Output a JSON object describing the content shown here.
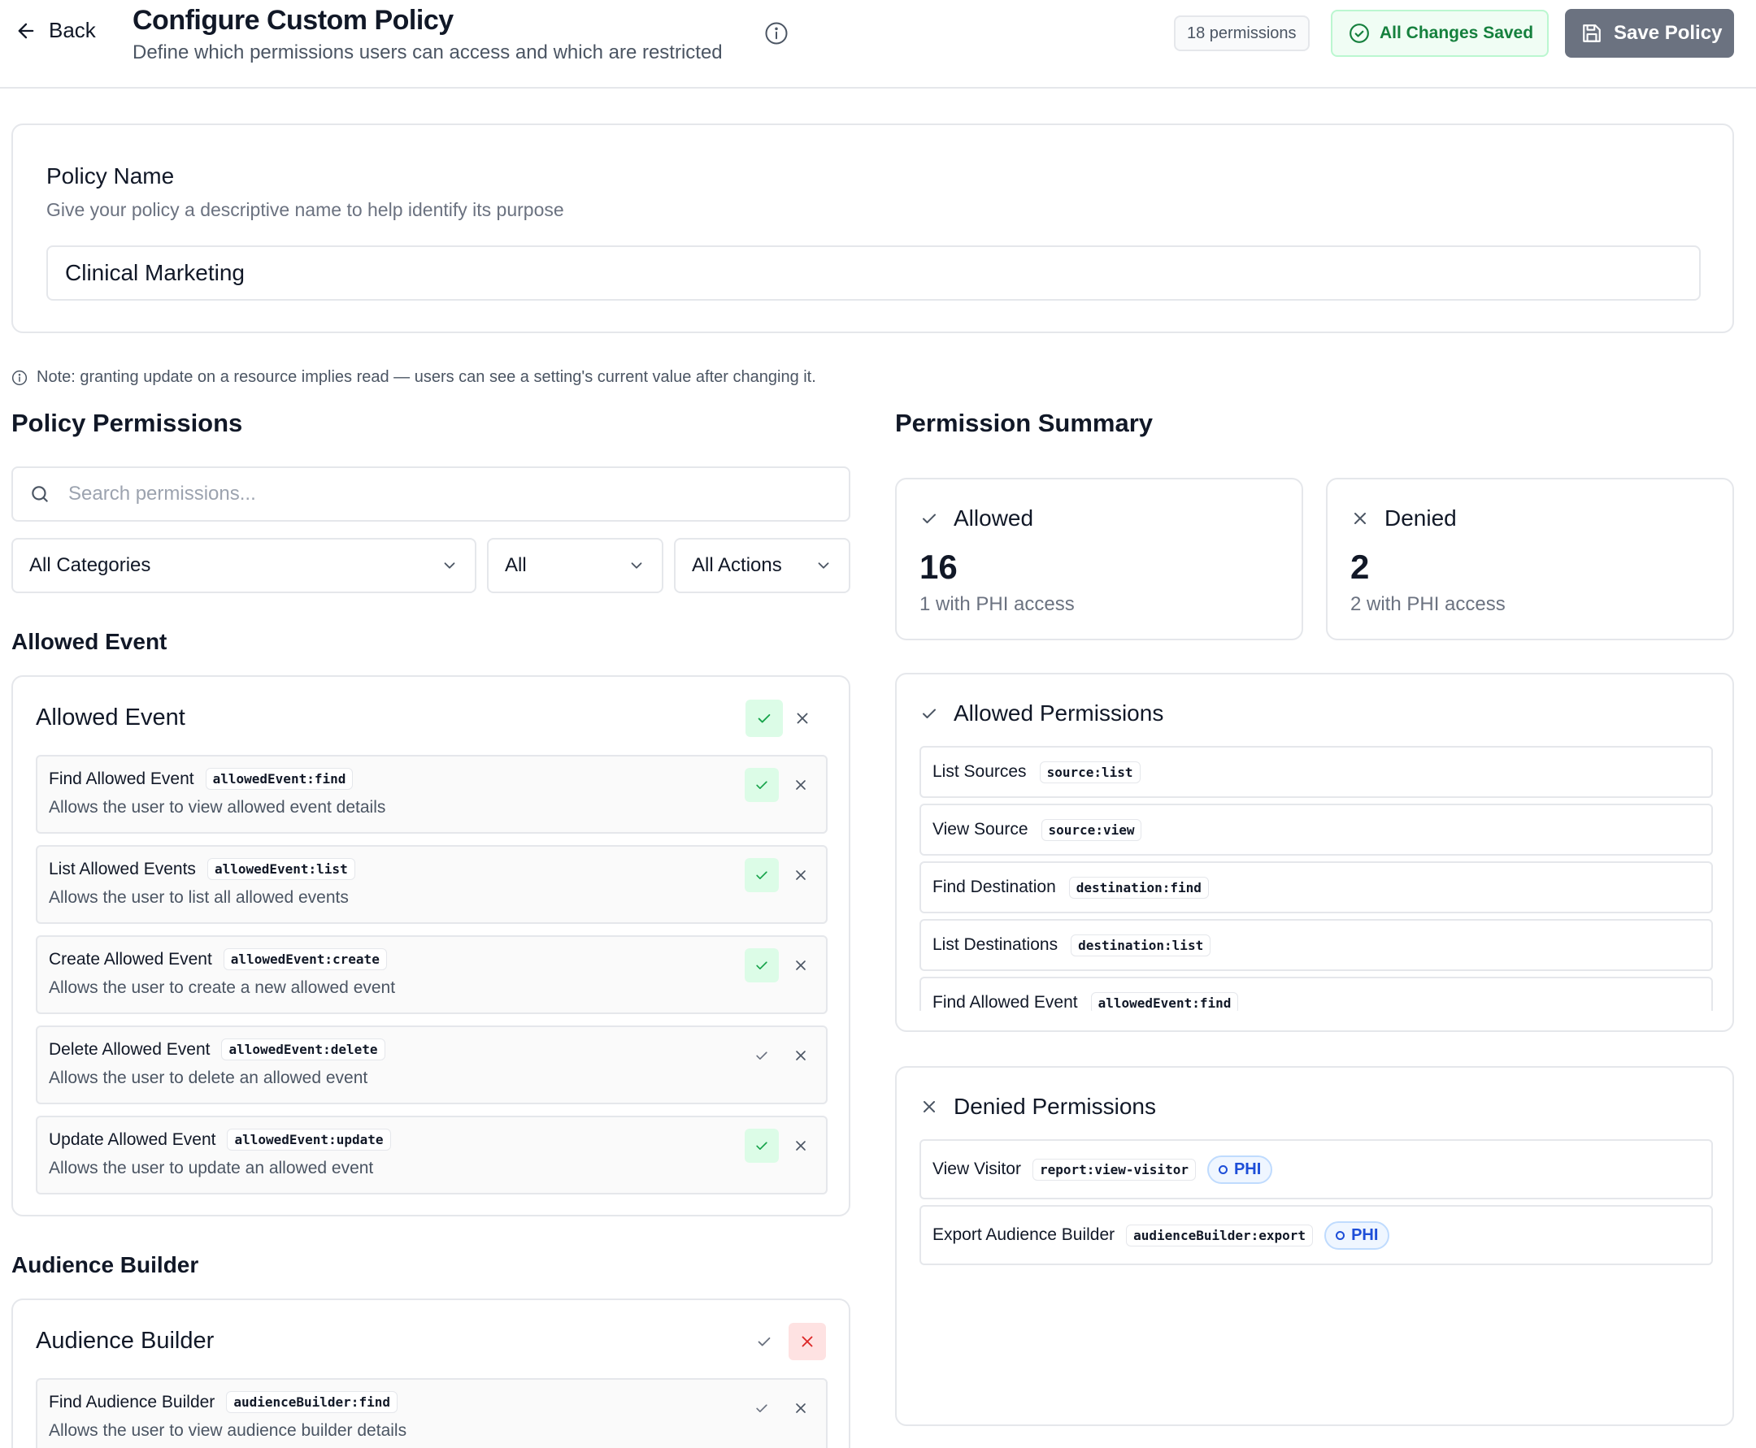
{
  "header": {
    "back_label": "Back",
    "title": "Configure Custom Policy",
    "subtitle": "Define which permissions users can access and which are restricted",
    "permission_count": "18 permissions",
    "saved_status": "All Changes Saved",
    "save_label": "Save Policy"
  },
  "policy_name": {
    "label": "Policy Name",
    "help": "Give your policy a descriptive name to help identify its purpose",
    "value": "Clinical Marketing"
  },
  "note": "Note: granting update on a resource implies read — users can see a setting's current value after changing it.",
  "permissions": {
    "title": "Policy Permissions",
    "search_placeholder": "Search permissions...",
    "filters": {
      "category": "All Categories",
      "status": "All",
      "action": "All Actions"
    },
    "groups": [
      {
        "section_title": "Allowed Event",
        "card_title": "Allowed Event",
        "group_state": "allowed",
        "items": [
          {
            "name": "Find Allowed Event",
            "code": "allowedEvent:find",
            "desc": "Allows the user to view allowed event details",
            "state": "allowed"
          },
          {
            "name": "List Allowed Events",
            "code": "allowedEvent:list",
            "desc": "Allows the user to list all allowed events",
            "state": "allowed"
          },
          {
            "name": "Create Allowed Event",
            "code": "allowedEvent:create",
            "desc": "Allows the user to create a new allowed event",
            "state": "allowed"
          },
          {
            "name": "Delete Allowed Event",
            "code": "allowedEvent:delete",
            "desc": "Allows the user to delete an allowed event",
            "state": "none"
          },
          {
            "name": "Update Allowed Event",
            "code": "allowedEvent:update",
            "desc": "Allows the user to update an allowed event",
            "state": "allowed"
          }
        ]
      },
      {
        "section_title": "Audience Builder",
        "card_title": "Audience Builder",
        "group_state": "denied",
        "items": [
          {
            "name": "Find Audience Builder",
            "code": "audienceBuilder:find",
            "desc": "Allows the user to view audience builder details",
            "state": "none"
          }
        ]
      }
    ]
  },
  "summary": {
    "title": "Permission Summary",
    "allowed": {
      "label": "Allowed",
      "count": "16",
      "phi": "1 with PHI access"
    },
    "denied": {
      "label": "Denied",
      "count": "2",
      "phi": "2 with PHI access"
    },
    "allowed_list": {
      "title": "Allowed Permissions",
      "items": [
        {
          "name": "List Sources",
          "code": "source:list"
        },
        {
          "name": "View Source",
          "code": "source:view"
        },
        {
          "name": "Find Destination",
          "code": "destination:find"
        },
        {
          "name": "List Destinations",
          "code": "destination:list"
        },
        {
          "name": "Find Allowed Event",
          "code": "allowedEvent:find"
        }
      ]
    },
    "denied_list": {
      "title": "Denied Permissions",
      "items": [
        {
          "name": "View Visitor",
          "code": "report:view-visitor",
          "badge": "PHI"
        },
        {
          "name": "Export Audience Builder",
          "code": "audienceBuilder:export",
          "badge": "PHI"
        }
      ]
    }
  },
  "colors": {
    "allow_bg": "#dcfce7",
    "allow_fg": "#16a34a",
    "deny_bg": "#fee2e2",
    "deny_fg": "#dc2626",
    "phi_fg": "#1d4ed8",
    "save_button": "#6b7280"
  }
}
